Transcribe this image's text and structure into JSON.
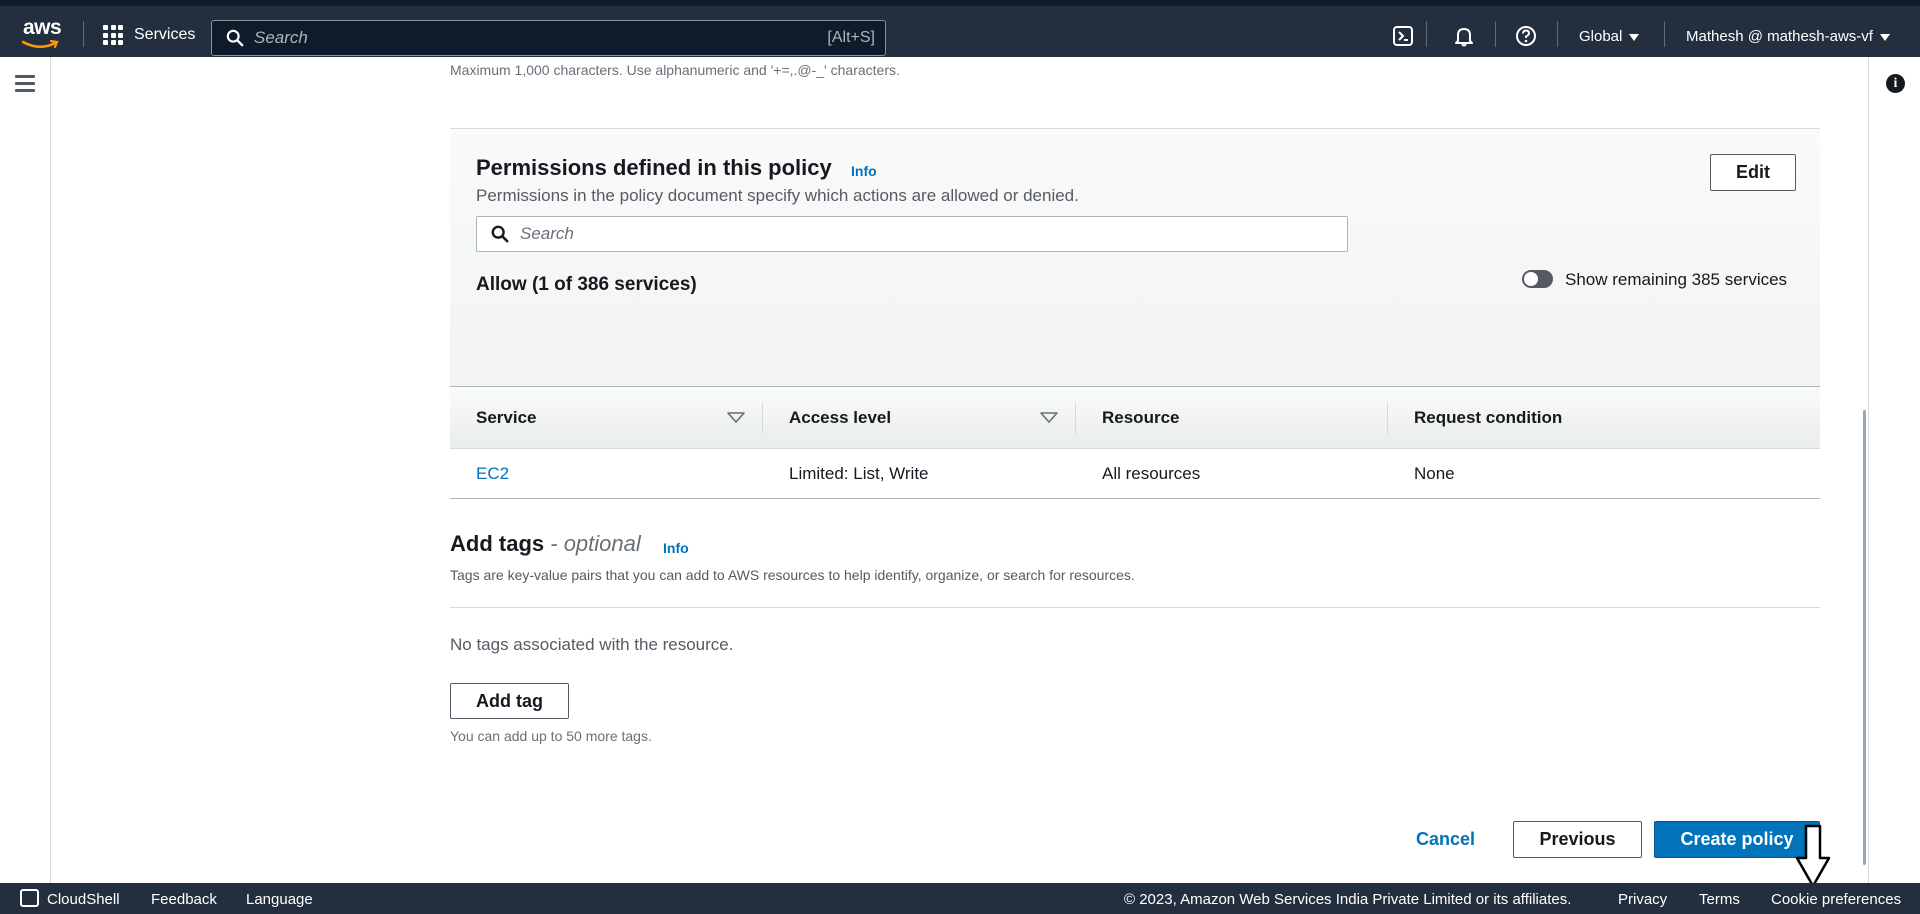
{
  "topnav": {
    "logo_text": "aws",
    "services_label": "Services",
    "search_placeholder": "Search",
    "search_shortcut": "[Alt+S]",
    "region_label": "Global",
    "account_label": "Mathesh @ mathesh-aws-vf"
  },
  "main": {
    "description_hint": "Maximum 1,000 characters. Use alphanumeric and '+=,.@-_' characters.",
    "permissions": {
      "title": "Permissions defined in this policy",
      "info_label": "Info",
      "description": "Permissions in the policy document specify which actions are allowed or denied.",
      "edit_label": "Edit",
      "search_placeholder": "Search",
      "allow_label": "Allow (1 of 386 services)",
      "toggle_label": "Show remaining 385 services",
      "toggle_on": false
    },
    "table": {
      "columns": [
        "Service",
        "Access level",
        "Resource",
        "Request condition"
      ],
      "rows": [
        {
          "service": "EC2",
          "access_level": "Limited: List, Write",
          "resource": "All resources",
          "request_condition": "None"
        }
      ]
    },
    "tags": {
      "title": "Add tags",
      "optional_label": "- optional",
      "info_label": "Info",
      "description": "Tags are key-value pairs that you can add to AWS resources to help identify, organize, or search for resources.",
      "empty_text": "No tags associated with the resource.",
      "add_tag_label": "Add tag",
      "limit_hint": "You can add up to 50 more tags."
    },
    "actions": {
      "cancel_label": "Cancel",
      "previous_label": "Previous",
      "create_label": "Create policy"
    }
  },
  "footer": {
    "cloudshell_label": "CloudShell",
    "feedback_label": "Feedback",
    "language_label": "Language",
    "copyright": "© 2023, Amazon Web Services India Private Limited or its affiliates.",
    "privacy_label": "Privacy",
    "terms_label": "Terms",
    "cookie_label": "Cookie preferences"
  },
  "colors": {
    "nav_bg": "#232f3e",
    "link_blue": "#0073bb",
    "primary_button": "#0073bb"
  }
}
